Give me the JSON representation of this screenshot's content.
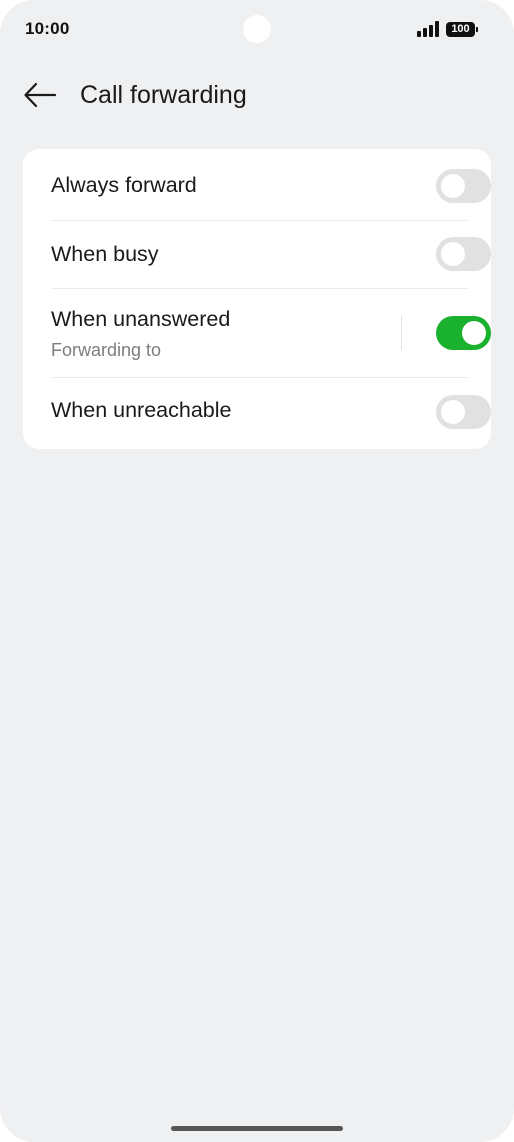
{
  "status_bar": {
    "time": "10:00",
    "battery": "100",
    "signal_icon": "signal-bars-icon",
    "battery_icon": "battery-icon"
  },
  "header": {
    "back_icon": "arrow-left-icon",
    "title": "Call forwarding"
  },
  "settings": [
    {
      "label": "Always forward",
      "enabled": false
    },
    {
      "label": "When busy",
      "enabled": false
    },
    {
      "label": "When unanswered",
      "subtitle": "Forwarding to",
      "enabled": true
    },
    {
      "label": "When unreachable",
      "enabled": false
    }
  ],
  "colors": {
    "background": "#eff0f2",
    "card": "#ffffff",
    "toggle_on": "#19b12e",
    "toggle_off": "#e1e1e1"
  }
}
